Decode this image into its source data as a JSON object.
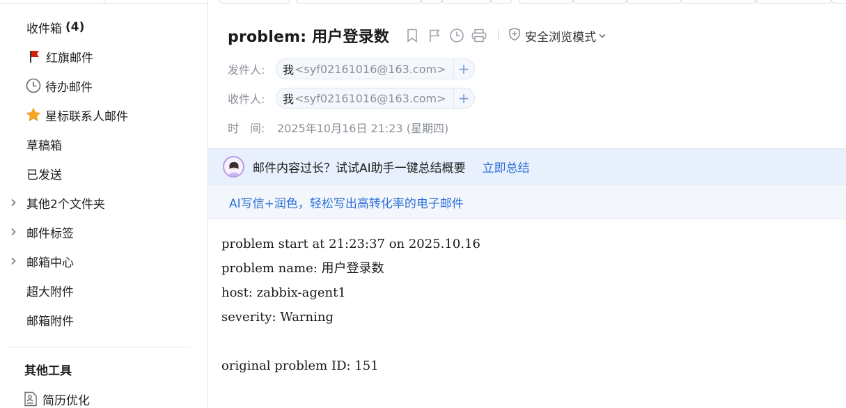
{
  "sidebar": {
    "items": [
      {
        "label": "收件箱",
        "count": "(4)"
      },
      {
        "label": "红旗邮件",
        "icon": "red-flag-icon"
      },
      {
        "label": "待办邮件",
        "icon": "clock-icon"
      },
      {
        "label": "星标联系人邮件",
        "icon": "star-icon"
      },
      {
        "label": "草稿箱"
      },
      {
        "label": "已发送"
      },
      {
        "label": "其他2个文件夹",
        "icon": "chevron-right-icon"
      },
      {
        "label": "邮件标签",
        "icon": "chevron-right-icon"
      },
      {
        "label": "邮箱中心",
        "icon": "chevron-right-icon"
      },
      {
        "label": "超大附件"
      },
      {
        "label": "邮箱附件"
      }
    ],
    "tools_heading": "其他工具",
    "tools": [
      {
        "label": "简历优化",
        "icon": "resume-icon"
      }
    ]
  },
  "email": {
    "subject": "problem: 用户登录数",
    "safe_mode_label": "安全浏览模式",
    "from_label": "发件人:",
    "from_name": "我",
    "from_addr": "<syf02161016@163.com>",
    "to_label": "收件人:",
    "to_name": "我",
    "to_addr": "<syf02161016@163.com>",
    "time_label": "时　间:",
    "time_value": "2025年10月16日 21:23 (星期四)",
    "plus": "+"
  },
  "ai": {
    "summary_text": "邮件内容过长？试试AI助手一键总结概要",
    "summary_link": "立即总结",
    "write_link": "AI写信+润色，轻松写出高转化率的电子邮件"
  },
  "body": {
    "lines": [
      "problem start at 21:23:37 on 2025.10.16",
      "problem name: 用户登录数",
      "host: zabbix-agent1",
      "severity: Warning",
      "",
      "original problem ID: 151"
    ]
  },
  "colors": {
    "accent": "#2a6fdb",
    "ai_bar_bg": "#e8f0fd",
    "flag_red": "#d81e06",
    "star_orange": "#f5a623"
  }
}
